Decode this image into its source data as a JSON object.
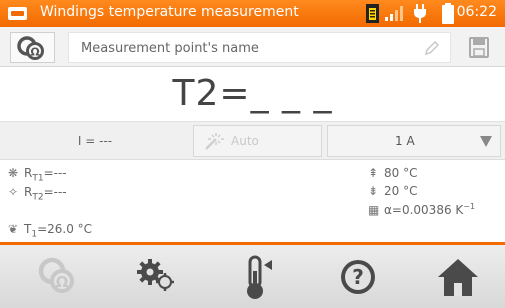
{
  "titlebar": {
    "title": "Windings temperature measurement",
    "time": "06:22"
  },
  "name_row": {
    "placeholder": "Measurement point's name"
  },
  "result": {
    "label": "T",
    "sub": "2",
    "value": "=_ _ _"
  },
  "controls": {
    "current": "I = ---",
    "auto_label": "Auto",
    "range_value": "1 A"
  },
  "info": {
    "rt1": {
      "label": "R",
      "sub": "T1",
      "value": "=---"
    },
    "rt2": {
      "label": "R",
      "sub": "T2",
      "value": "=---"
    },
    "t1": {
      "label": "T",
      "sub": "1",
      "value": "=26.0 °C"
    },
    "temp_high": "80 °C",
    "temp_low": "20 °C",
    "alpha": {
      "label": "α=0.00386 K",
      "sup": "−1"
    }
  },
  "toolbar": {
    "buttons": [
      "probe-icon",
      "settings-icon",
      "thermometer-icon",
      "help-icon",
      "home-icon"
    ]
  },
  "colors": {
    "accent": "#f26a00",
    "toolbar_icon": "#4a4a4a",
    "disabled_icon": "#c8c8c8"
  }
}
